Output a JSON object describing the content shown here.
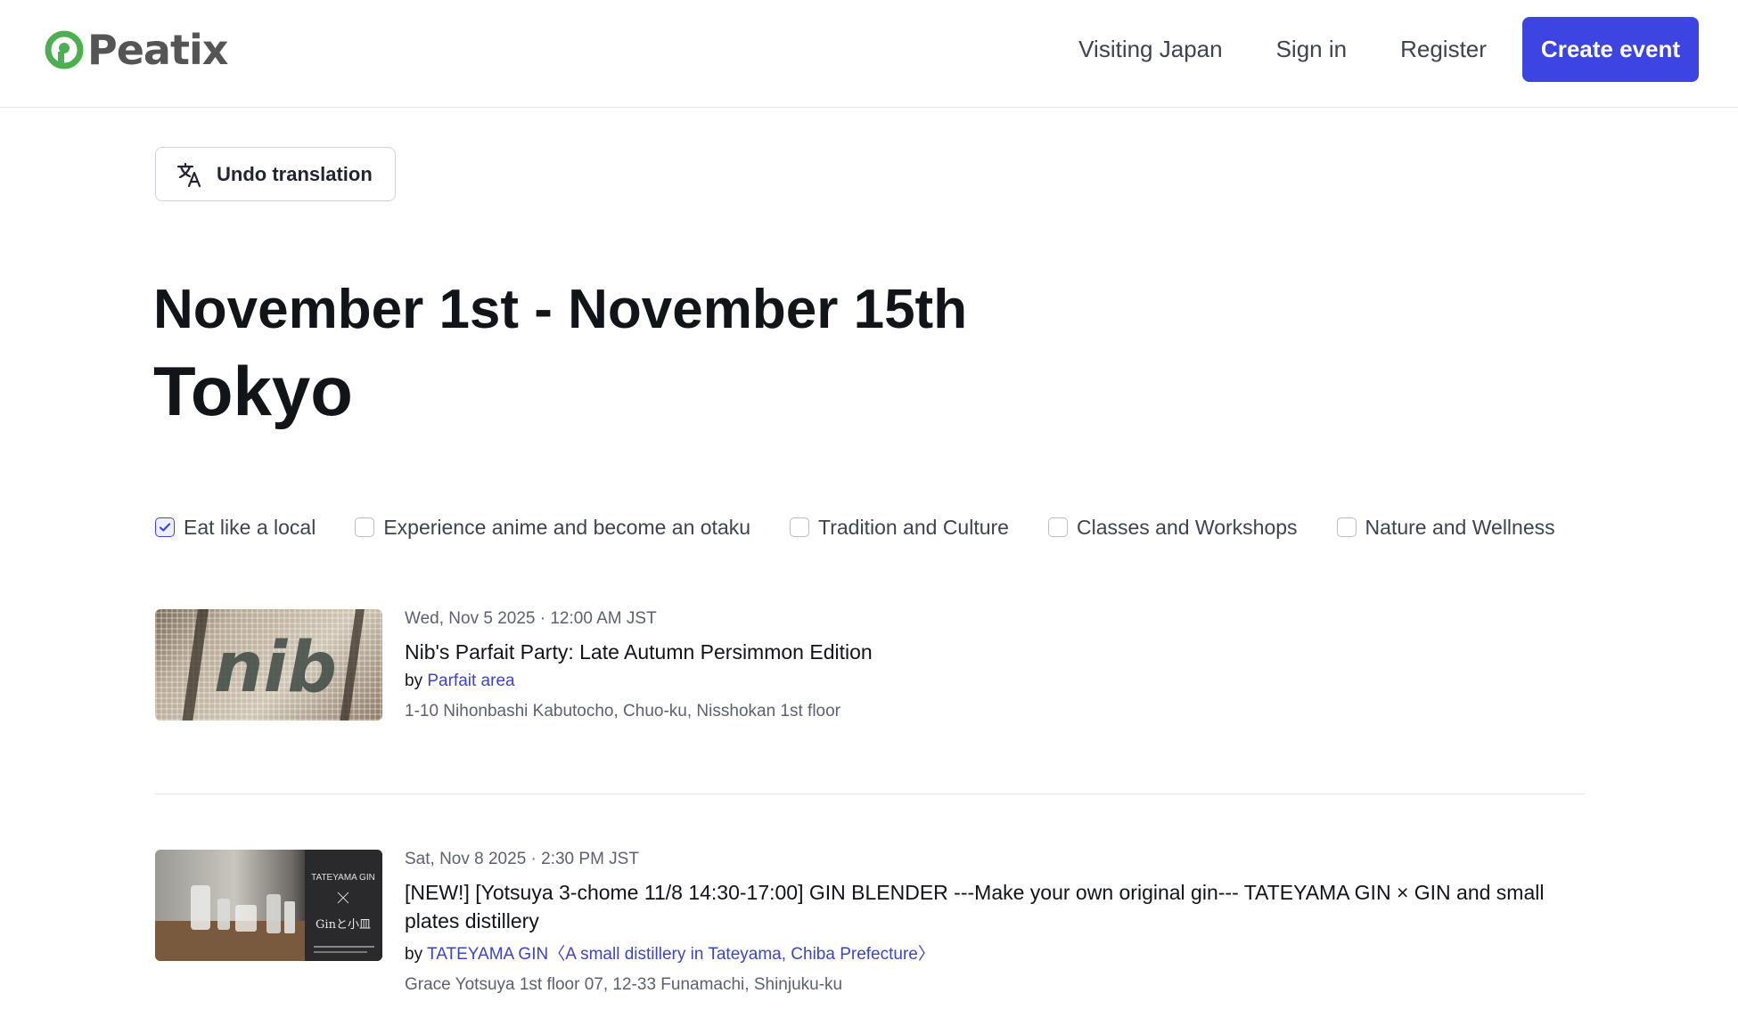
{
  "header": {
    "logo_text": "Peatix",
    "nav": [
      "Visiting Japan",
      "Sign in",
      "Register"
    ],
    "create_label": "Create event"
  },
  "translation": {
    "undo_label": "Undo translation"
  },
  "page": {
    "date_range": "November 1st - November 15th",
    "city": "Tokyo"
  },
  "filters": [
    {
      "label": "Eat like a local",
      "checked": true
    },
    {
      "label": "Experience anime and become an otaku",
      "checked": false
    },
    {
      "label": "Tradition and Culture",
      "checked": false
    },
    {
      "label": "Classes and Workshops",
      "checked": false
    },
    {
      "label": "Nature and Wellness",
      "checked": false
    }
  ],
  "events": [
    {
      "date": "Wed, Nov 5 2025 · 12:00 AM JST",
      "title": "Nib's Parfait Party: Late Autumn Persimmon Edition",
      "by": "by",
      "organizer": "Parfait area",
      "address": "1-10 Nihonbashi Kabutocho, Chuo-ku, Nisshokan 1st floor",
      "thumb_text": "nib"
    },
    {
      "date": "Sat, Nov 8 2025 · 2:30 PM JST",
      "title": "[NEW!] [Yotsuya 3-chome 11/8 14:30-17:00] GIN BLENDER ---Make your own original gin--- TATEYAMA GIN × GIN and small plates distillery",
      "by": "by",
      "organizer": "TATEYAMA GIN〈A small distillery in Tateyama, Chiba Prefecture〉",
      "address": "Grace Yotsuya 1st floor 07, 12-33 Funamachi, Shinjuku-ku",
      "thumb_text": "TATEYAMA GIN",
      "thumb_sub": "Ginと小皿"
    }
  ],
  "colors": {
    "brand_green": "#4caf50",
    "accent": "#3d44e1",
    "link": "#3d44c8"
  }
}
